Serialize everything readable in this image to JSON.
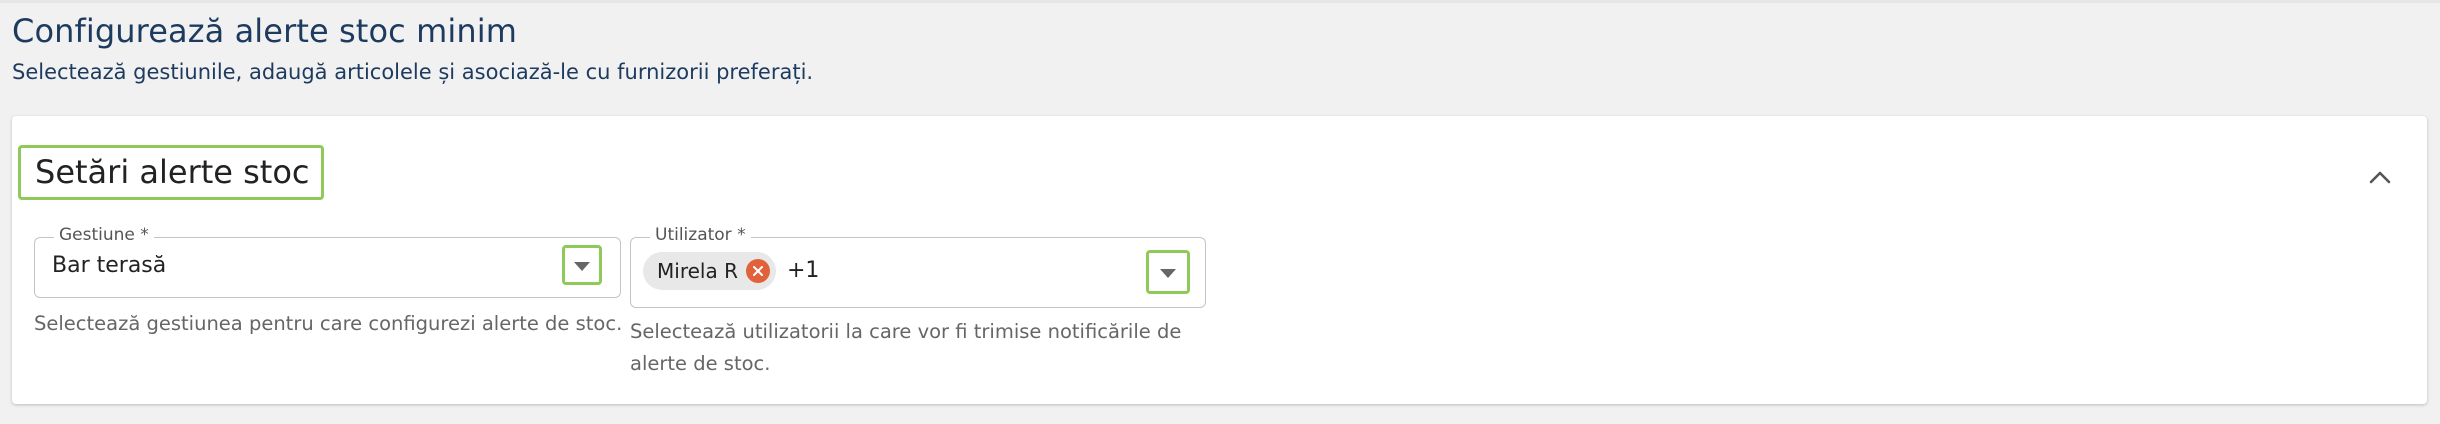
{
  "header": {
    "title": "Configurează alerte stoc minim",
    "subtitle": "Selectează gestiunile, adaugă articolele și asociază-le cu furnizorii preferați."
  },
  "card": {
    "title": "Setări alerte stoc",
    "collapse_icon": "chevron-up-icon",
    "gestiune": {
      "label": "Gestiune *",
      "value": "Bar terasă",
      "helper": "Selectează gestiunea pentru care configurezi alerte de stoc.",
      "dropdown_icon": "caret-down-icon"
    },
    "utilizator": {
      "label": "Utilizator *",
      "chips": [
        {
          "label": "Mirela R"
        }
      ],
      "extra": "+1",
      "helper": "Selectează utilizatorii la care vor fi trimise notificările de alerte de stoc.",
      "dropdown_icon": "caret-down-icon"
    }
  },
  "colors": {
    "accent_highlight": "#8fc95a",
    "title_text": "#1d3a5f",
    "chip_remove": "#e0613a"
  }
}
